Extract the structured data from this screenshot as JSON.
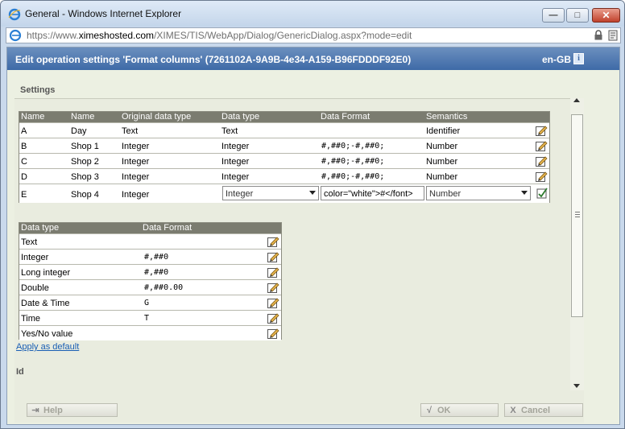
{
  "window": {
    "title": "General - Windows Internet Explorer",
    "url_prefix": "https://www.",
    "url_domain": "ximeshosted.com",
    "url_path": "/XIMES/TIS/WebApp/Dialog/GenericDialog.aspx?mode=edit",
    "minimize_glyph": "—",
    "maximize_glyph": "□",
    "close_glyph": "✕"
  },
  "header": {
    "title": "Edit operation settings 'Format columns' (7261102A-9A9B-4e34-A159-B96FDDDF92E0)",
    "locale": "en-GB",
    "info_glyph": "i"
  },
  "settings": {
    "title": "Settings",
    "columns_table": {
      "headers": [
        "Name",
        "Name",
        "Original data type",
        "Data type",
        "Data Format",
        "Semantics"
      ],
      "rows": [
        {
          "name": "A",
          "display_name": "Day",
          "original_type": "Text",
          "data_type": "Text",
          "data_format": "",
          "semantics": "Identifier"
        },
        {
          "name": "B",
          "display_name": "Shop 1",
          "original_type": "Integer",
          "data_type": "Integer",
          "data_format": "#,##0;-#,##0;",
          "semantics": "Number"
        },
        {
          "name": "C",
          "display_name": "Shop 2",
          "original_type": "Integer",
          "data_type": "Integer",
          "data_format": "#,##0;-#,##0;",
          "semantics": "Number"
        },
        {
          "name": "D",
          "display_name": "Shop 3",
          "original_type": "Integer",
          "data_type": "Integer",
          "data_format": "#,##0;-#,##0;",
          "semantics": "Number"
        }
      ],
      "edit_row": {
        "name": "E",
        "display_name": "Shop 4",
        "original_type": "Integer",
        "data_type": "Integer",
        "data_format": "color=\"white\">#</font>",
        "semantics": "Number"
      }
    },
    "formats_table": {
      "headers": [
        "Data type",
        "Data Format"
      ],
      "rows": [
        {
          "type": "Text",
          "format": ""
        },
        {
          "type": "Integer",
          "format": "#,##0"
        },
        {
          "type": "Long integer",
          "format": "#,##0"
        },
        {
          "type": "Double",
          "format": "#,##0.00"
        },
        {
          "type": "Date & Time",
          "format": "G"
        },
        {
          "type": "Time",
          "format": "T"
        },
        {
          "type": "Yes/No value",
          "format": ""
        }
      ]
    },
    "apply_default": "Apply as default"
  },
  "id_section": {
    "title": "Id"
  },
  "footer": {
    "help_label": "Help",
    "ok_label": "OK",
    "cancel_label": "Cancel",
    "help_icon": "⇥",
    "ok_icon": "√",
    "cancel_icon": "X"
  }
}
